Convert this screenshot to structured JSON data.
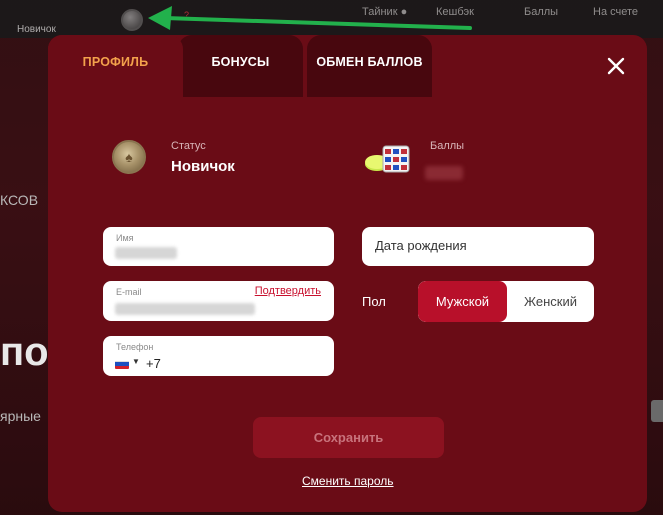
{
  "background": {
    "novice_label": "Новичок",
    "notification_dot": "?",
    "top_items": [
      "Тайник",
      "Кешбэк",
      "Баллы",
      "На счете"
    ],
    "left_texts": [
      "КСОВ",
      "по",
      "ярные"
    ]
  },
  "tabs": [
    {
      "label": "ПРОФИЛЬ",
      "active": true
    },
    {
      "label": "БОНУСЫ",
      "active": false
    },
    {
      "label": "ОБМЕН БАЛЛОВ",
      "active": false
    }
  ],
  "status": {
    "label": "Статус",
    "value": "Новичок",
    "icon": "poker-chip-icon"
  },
  "points": {
    "label": "Баллы",
    "icon": "chips-stack-icon"
  },
  "form": {
    "name_label": "Имя",
    "email_label": "E-mail",
    "verify_link": "Подтвердить",
    "phone_label": "Телефон",
    "phone_code": "+7",
    "dob_placeholder": "Дата рождения",
    "gender_label": "Пол",
    "gender_male": "Мужской",
    "gender_female": "Женский",
    "gender_selected": "Мужской"
  },
  "actions": {
    "save": "Сохранить",
    "change_password": "Сменить пароль"
  },
  "colors": {
    "modal_bg": "#6a0c16",
    "active_tab_text": "#f3a24c",
    "primary_red": "#b8102a",
    "arrow_green": "#22b14c"
  }
}
